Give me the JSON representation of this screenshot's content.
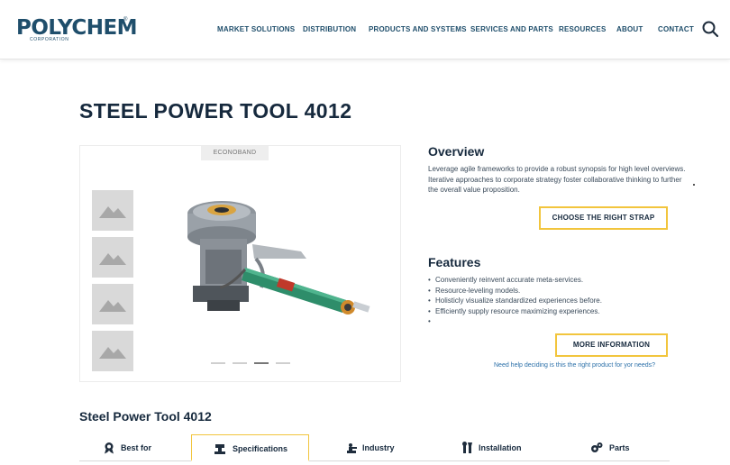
{
  "header": {
    "logo_text": "POLYCHEM",
    "logo_registered": "®",
    "logo_sub": "CORPORATION",
    "nav": [
      "MARKET SOLUTIONS",
      "DISTRIBUTION",
      "PRODUCTS AND SYSTEMS",
      "SERVICES AND PARTS",
      "RESOURCES",
      "ABOUT",
      "CONTACT"
    ],
    "search_icon": "search-icon"
  },
  "page": {
    "title": "STEEL POWER TOOL 4012"
  },
  "gallery": {
    "badge": "ECONOBAND",
    "thumbnail_icon": "image-placeholder-icon",
    "thumbnail_count": 4,
    "slide_count": 4,
    "active_slide": 3
  },
  "overview": {
    "heading": "Overview",
    "text": "Leverage agile frameworks to provide a robust synopsis for high level overviews. Iterative approaches to corporate strategy foster collaborative thinking to further the overall value proposition.",
    "button": "CHOOSE THE RIGHT STRAP"
  },
  "features": {
    "heading": "Features",
    "items": [
      "Conveniently reinvent accurate meta-services.",
      "Resource-leveling models.",
      "Holisticly visualize standardized experiences before.",
      "Efficiently supply resource maximizing experiences.",
      ""
    ],
    "button": "MORE INFORMATION",
    "help_link": "Need help deciding is this the right product for yor needs?"
  },
  "product_section": {
    "subtitle": "Steel Power Tool 4012",
    "tabs": [
      {
        "label": "Best for",
        "icon": "award-icon"
      },
      {
        "label": "Specifications",
        "icon": "machine-icon"
      },
      {
        "label": "Industry",
        "icon": "industry-icon"
      },
      {
        "label": "Installation",
        "icon": "tools-icon"
      },
      {
        "label": "Parts",
        "icon": "gears-icon"
      }
    ],
    "active_tab": 1
  },
  "colors": {
    "brand": "#1f4e6b",
    "accent": "#f2c53d",
    "link": "#2a6fa8",
    "heading": "#16293d"
  }
}
